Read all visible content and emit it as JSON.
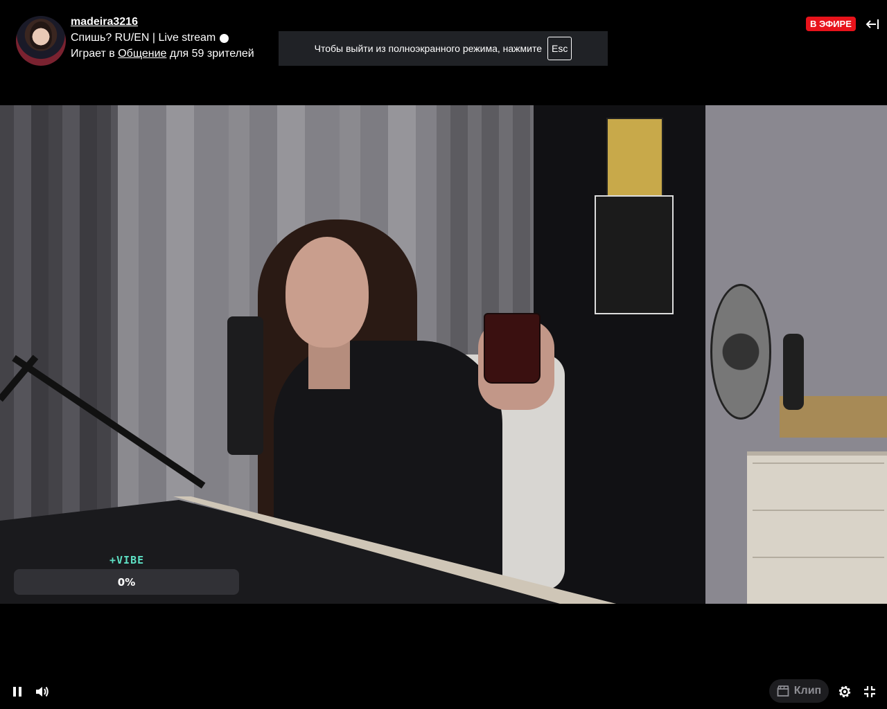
{
  "channel": {
    "name": "madeira3216",
    "title": "Спишь? RU/EN | Live stream",
    "meta_prefix": "Играет в",
    "category": "Общение",
    "meta_suffix": "для 59 зрителей"
  },
  "fullscreen_notice": {
    "text": "Чтобы выйти из полноэкранного режима, нажмите",
    "key": "Esc"
  },
  "live_badge": "В ЭФИРЕ",
  "vibe_overlay": {
    "label": "+VIBE",
    "value_text": "0%",
    "progress": 0
  },
  "controls": {
    "clip_label": "Клип"
  },
  "colors": {
    "live_red": "#e8131b",
    "vibe_accent": "#5ee0c4",
    "notice_bg": "#202226"
  },
  "icons": {
    "pause": "pause-icon",
    "volume": "volume-icon",
    "clip": "clapperboard-icon",
    "settings": "gear-icon",
    "exit_fullscreen": "exit-fullscreen-icon",
    "collapse": "arrow-left-bar-icon"
  }
}
